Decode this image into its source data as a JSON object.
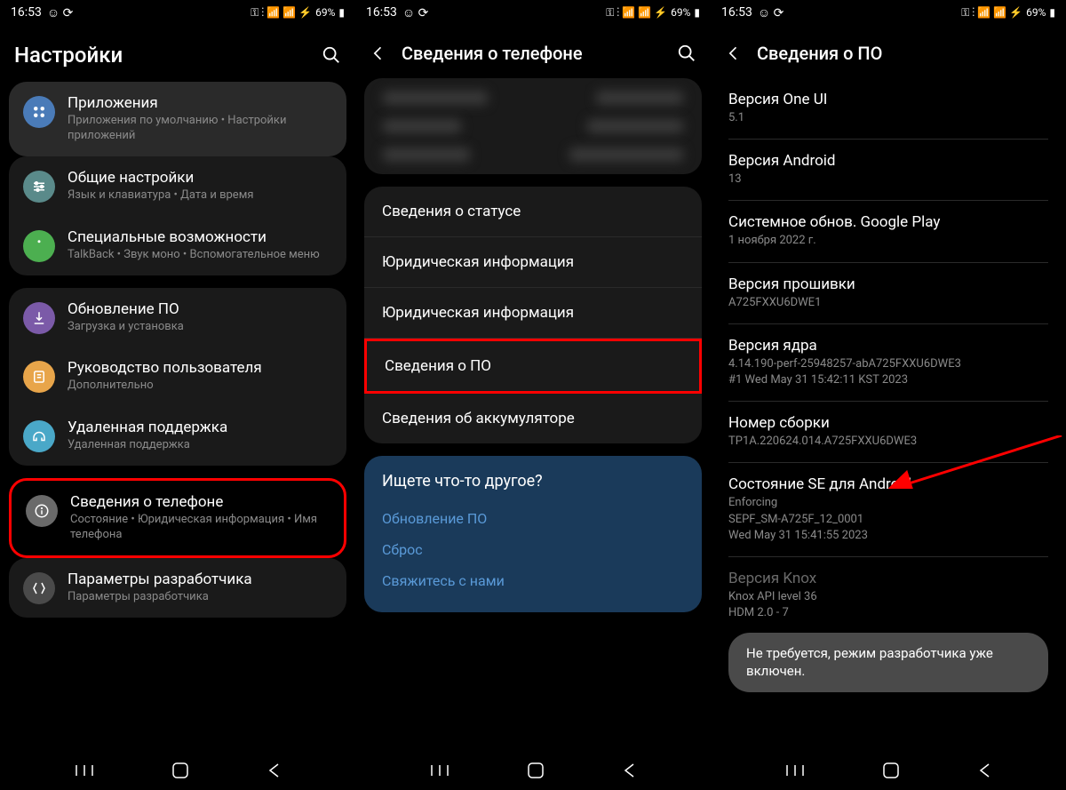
{
  "statusBar": {
    "time": "16:53",
    "battery": "69%"
  },
  "screen1": {
    "title": "Настройки",
    "items": [
      {
        "title": "Приложения",
        "sub": "Приложения по умолчанию • Настройки приложений"
      },
      {
        "title": "Общие настройки",
        "sub": "Язык и клавиатура • Дата и время"
      },
      {
        "title": "Специальные возможности",
        "sub": "TalkBack • Звук моно • Вспомогательное меню"
      },
      {
        "title": "Обновление ПО",
        "sub": "Загрузка и установка"
      },
      {
        "title": "Руководство пользователя",
        "sub": "Дополнительно"
      },
      {
        "title": "Удаленная поддержка",
        "sub": "Удаленная поддержка"
      },
      {
        "title": "Сведения о телефоне",
        "sub": "Состояние • Юридическая информация • Имя телефона"
      },
      {
        "title": "Параметры разработчика",
        "sub": "Параметры разработчика"
      }
    ]
  },
  "screen2": {
    "title": "Сведения о телефоне",
    "items": [
      "Сведения о статусе",
      "Юридическая информация",
      "Юридическая информация",
      "Сведения о ПО",
      "Сведения об аккумуляторе"
    ],
    "suggest": {
      "title": "Ищете что-то другое?",
      "links": [
        "Обновление ПО",
        "Сброс",
        "Свяжитесь с нами"
      ]
    }
  },
  "screen3": {
    "title": "Сведения о ПО",
    "items": [
      {
        "title": "Версия One UI",
        "value": "5.1"
      },
      {
        "title": "Версия Android",
        "value": "13"
      },
      {
        "title": "Системное обнов. Google Play",
        "value": "1 ноября 2022 г."
      },
      {
        "title": "Версия прошивки",
        "value": "A725FXXU6DWE1"
      },
      {
        "title": "Версия ядра",
        "value": "4.14.190-perf-25948257-abA725FXXU6DWE3\n#1 Wed May 31 15:42:11 KST 2023"
      },
      {
        "title": "Номер сборки",
        "value": "TP1A.220624.014.A725FXXU6DWE3"
      },
      {
        "title": "Состояние SE для Android",
        "value": "Enforcing\nSEPF_SM-A725F_12_0001\nWed May 31 15:41:55 2023"
      },
      {
        "title": "Версия Knox",
        "value": "Knox API level 36\nHDM 2.0 - 7"
      }
    ],
    "toast": "Не требуется, режим разработчика уже включен."
  }
}
